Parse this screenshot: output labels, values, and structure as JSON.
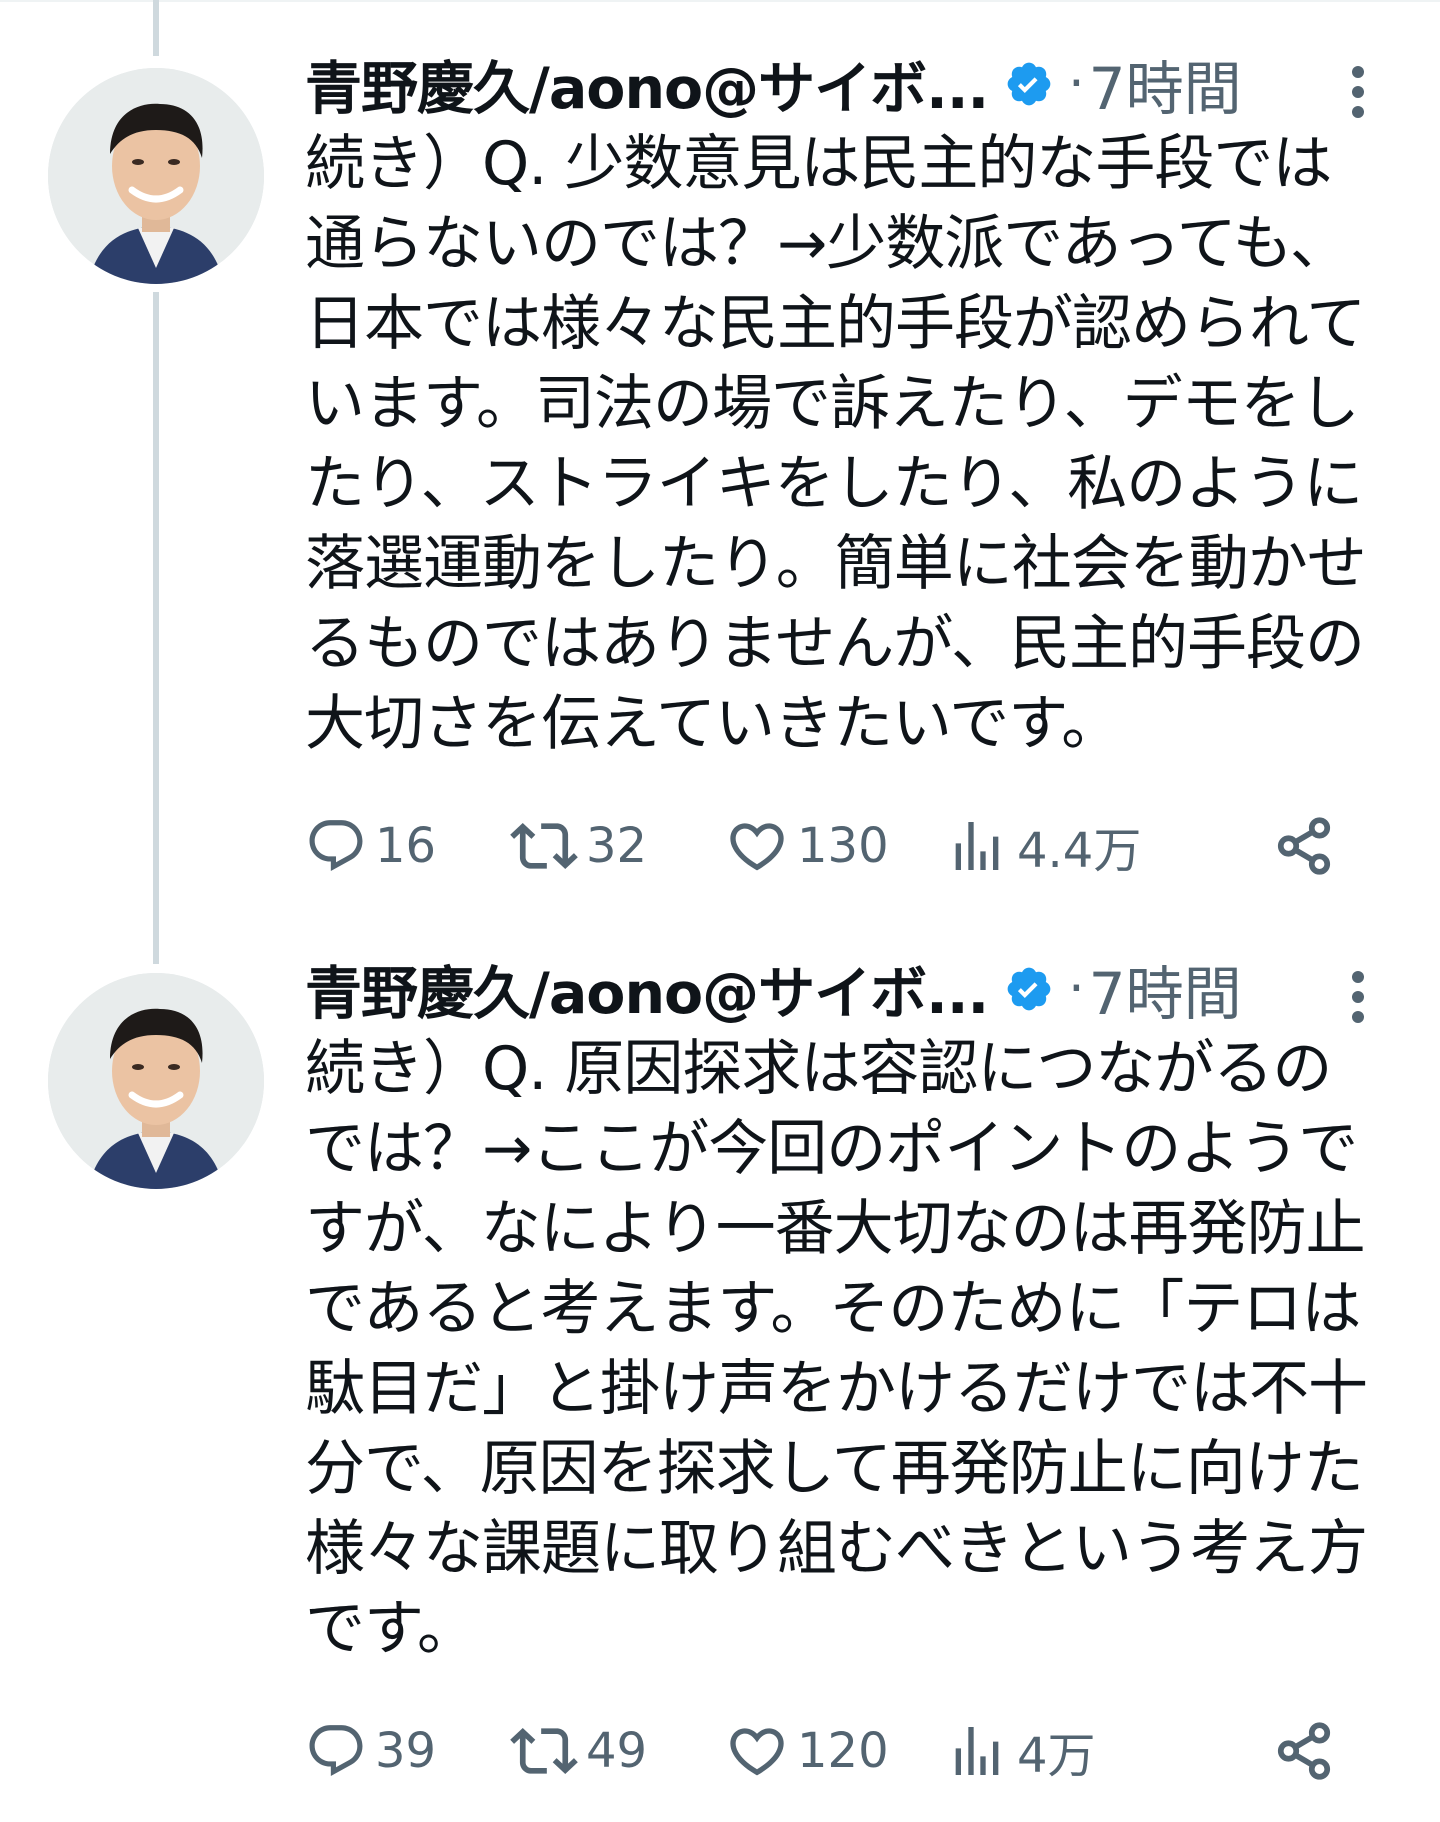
{
  "tweets": [
    {
      "author": "青野慶久/aono@サイボ...",
      "separator": "·",
      "time": "7時間",
      "lines": [
        "続き）Q. 少数意見は民主的な手段では",
        "通らないのでは？→少数派であっても、",
        "日本では様々な民主的手段が認められて",
        "います。司法の場で訴えたり、デモをし",
        "たり、ストライキをしたり、私のように",
        "落選運動をしたり。簡単に社会を動かせ",
        "るものではありませんが、民主的手段の",
        "大切さを伝えていきたいです。"
      ],
      "replies": "16",
      "retweets": "32",
      "likes": "130",
      "views": "4.4万"
    },
    {
      "author": "青野慶久/aono@サイボ...",
      "separator": "·",
      "time": "7時間",
      "lines": [
        "続き）Q. 原因探求は容認につながるの",
        "では？→ここが今回のポイントのようで",
        "すが、なにより一番大切なのは再発防止",
        "であると考えます。そのために「テロは",
        "駄目だ」と掛け声をかけるだけでは不十",
        "分で、原因を探求して再発防止に向けた",
        "様々な課題に取り組むべきという考え方",
        "です。"
      ],
      "replies": "39",
      "retweets": "49",
      "likes": "120",
      "views": "4万"
    }
  ],
  "icons": {
    "verified": "verified-badge-icon",
    "more": "more-icon",
    "reply": "reply-icon",
    "retweet": "retweet-icon",
    "like": "heart-icon",
    "views": "views-icon",
    "share": "share-icon"
  },
  "colors": {
    "verified": "#1d9bf0",
    "muted": "#536471",
    "text": "#0f1419",
    "thread_line": "#cfd9de"
  }
}
